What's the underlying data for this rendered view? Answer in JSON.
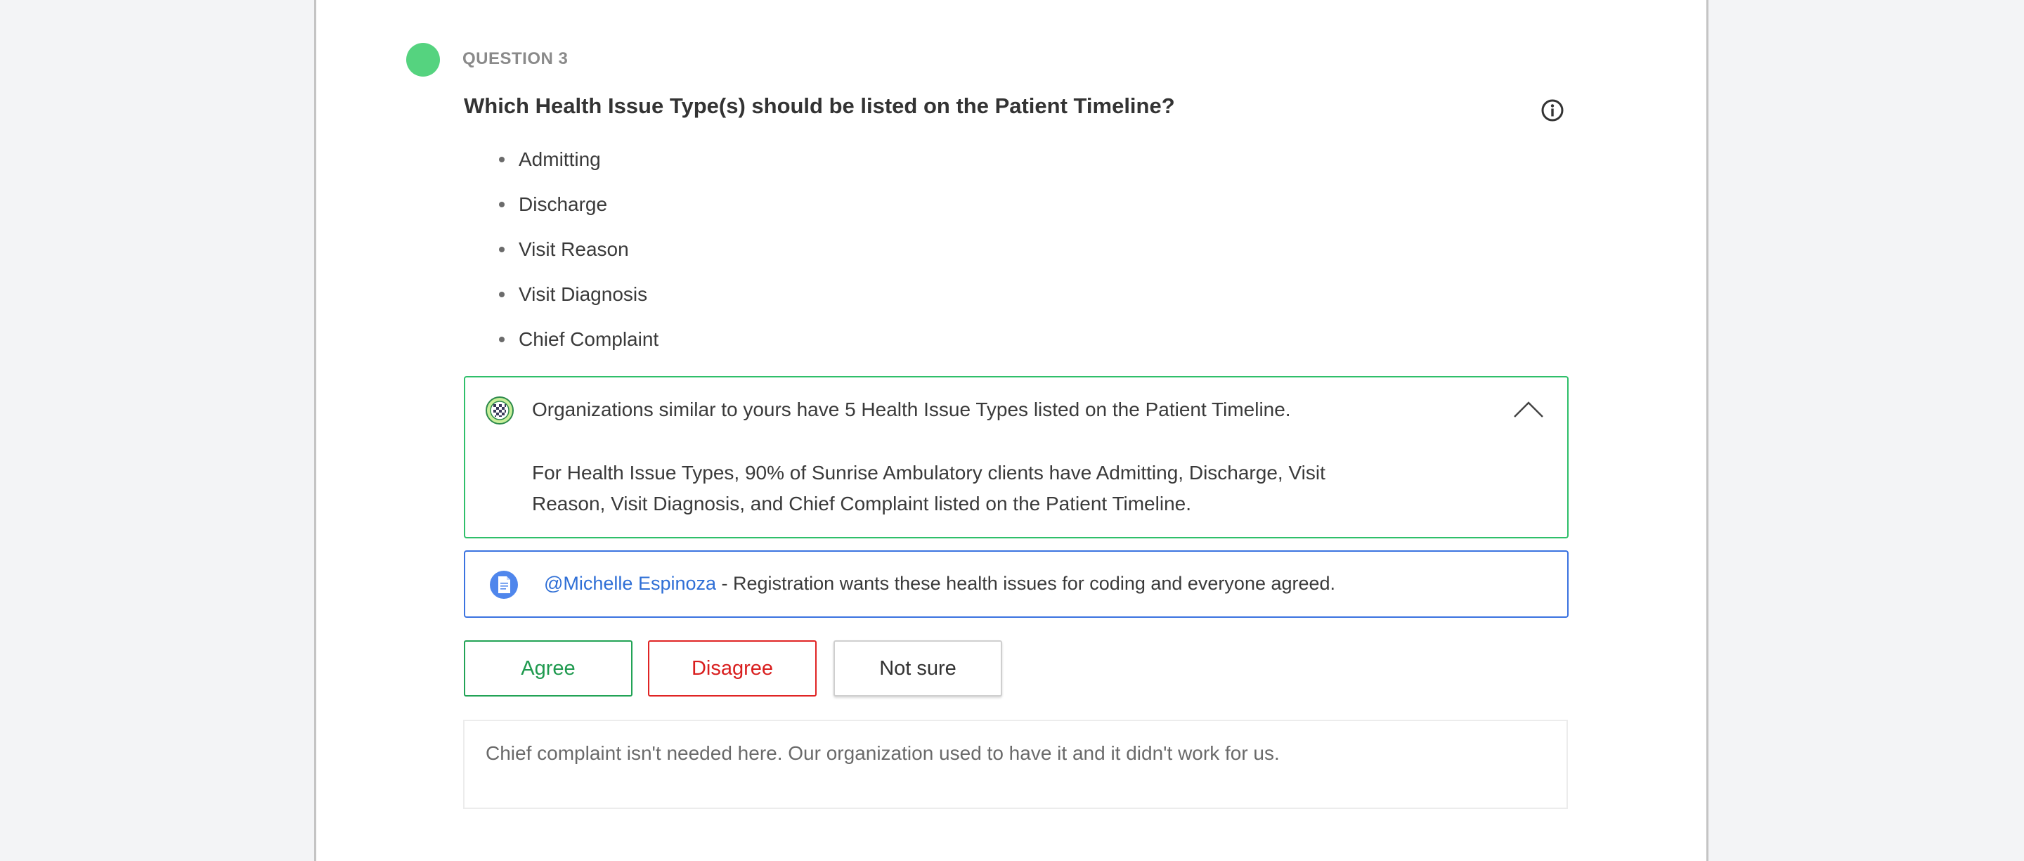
{
  "question": {
    "number_label": "QUESTION 3",
    "title": "Which Health Issue Type(s) should be listed on the Patient Timeline?",
    "status_color": "#55d37f",
    "options": [
      "Admitting",
      "Discharge",
      "Visit Reason",
      "Visit Diagnosis",
      "Chief Complaint"
    ]
  },
  "insight": {
    "icon": "checker-badge-icon",
    "headline": "Organizations similar to yours have 5 Health Issue Types listed on the Patient Timeline.",
    "body": "For Health Issue Types, 90% of Sunrise Ambulatory clients have Admitting, Discharge, Visit Reason, Visit Diagnosis, and Chief Complaint listed on the Patient Timeline.",
    "accent": "#2fbf6a"
  },
  "comment": {
    "icon": "document-icon",
    "mention": "@Michelle Espinoza",
    "text": " - Registration wants these health issues for coding and everyone agreed.",
    "accent": "#3b73e0"
  },
  "actions": {
    "agree": "Agree",
    "disagree": "Disagree",
    "not_sure": "Not sure"
  },
  "note": {
    "text": "Chief complaint isn't needed here. Our organization used to have it and it didn't work for us."
  }
}
